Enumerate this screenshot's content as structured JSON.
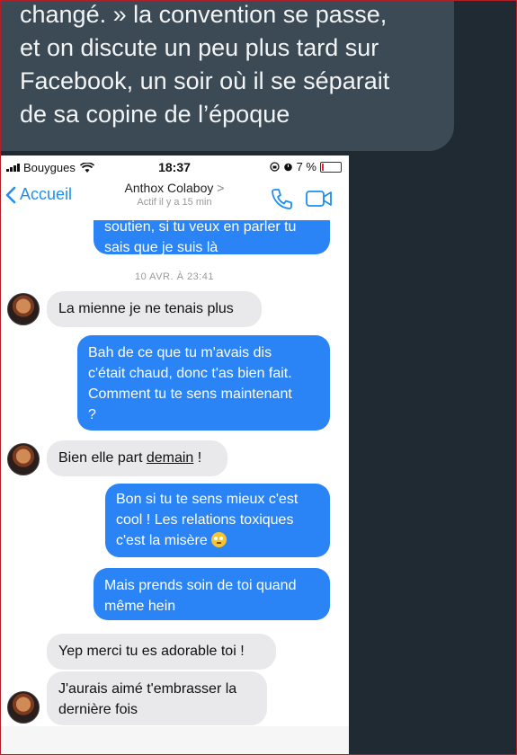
{
  "caption": {
    "lines": [
      "changé. » la convention se passe,",
      "et on discute un peu plus tard sur",
      "Facebook, un soir où il se séparait",
      "de sa copine de l’époque"
    ]
  },
  "status_bar": {
    "carrier": "Bouygues",
    "time": "18:37",
    "battery": "7 %"
  },
  "nav": {
    "back_label": "Accueil",
    "contact_name": "Anthox Colaboy",
    "chevron": ">",
    "active_status": "Actif il y a 15 min"
  },
  "messages": {
    "m0_line1": "soutien, si tu veux en parler tu",
    "m0_line2": "sais que je suis là",
    "timestamp": "10 AVR. À 23:41",
    "m1": "La mienne je ne tenais plus",
    "m2_line1": "Bah de ce que tu m'avais dis",
    "m2_line2": "c'était chaud, donc t'as bien fait.",
    "m2_line3": "Comment tu te sens maintenant",
    "m2_line4": "?",
    "m3_prefix": "Bien elle part ",
    "m3_link": "demain",
    "m3_suffix": " !",
    "m4_line1": "Bon si tu te sens mieux c'est",
    "m4_line2": "cool ! Les relations toxiques",
    "m4_line3": "c'est la misère",
    "m5_line1": "Mais prends soin de toi quand",
    "m5_line2": "même hein",
    "m6": "Yep merci tu es adorable toi !",
    "m7_line1": "J'aurais aimé t'embrasser la",
    "m7_line2": "dernière fois"
  },
  "colors": {
    "outgoing": "#2a84f6",
    "incoming": "#e9e9eb",
    "accent": "#1f8ef1",
    "background": "#1f2a33"
  },
  "icons": [
    "signal-bars-icon",
    "wifi-icon",
    "alarm-icon",
    "battery-icon",
    "back-chevron-icon",
    "phone-icon",
    "video-camera-icon",
    "eye-roll-emoji-icon"
  ]
}
